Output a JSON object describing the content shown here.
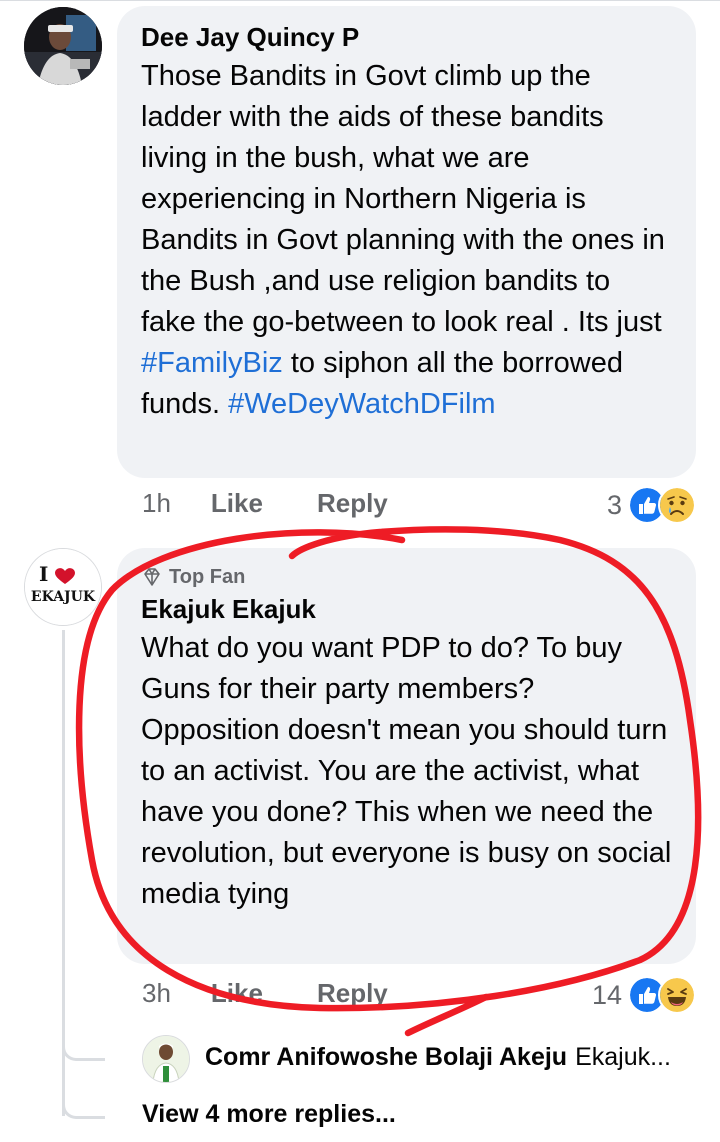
{
  "comments": [
    {
      "author": "Dee Jay Quincy P",
      "text_before": "Those Bandits in Govt climb up the ladder with the aids of these bandits living in the bush, what we are experiencing in Northern Nigeria is Bandits in Govt planning with the ones in the Bush ,and use religion bandits to fake the go-between to look real . Its just ",
      "hashtag1": "#FamilyBiz",
      "text_middle": " to siphon all the borrowed funds. ",
      "hashtag2": "#WeDeyWatchDFilm",
      "time": "1h",
      "like_label": "Like",
      "reply_label": "Reply",
      "reaction_count": "3",
      "reactions": [
        "like-reaction-icon",
        "sad-reaction-icon"
      ]
    },
    {
      "badge": "Top Fan",
      "author": "Ekajuk Ekajuk",
      "avatar_text_top": "I",
      "avatar_text_bottom": "EKAJUK",
      "text": "What do you want PDP to do? To buy Guns for their party members? Opposition doesn't mean you should turn to an activist. You are the activist, what have you done? This when we need the revolution, but everyone is busy on social media tying",
      "time": "3h",
      "like_label": "Like",
      "reply_label": "Reply",
      "reaction_count": "14",
      "reactions": [
        "like-reaction-icon",
        "haha-reaction-icon"
      ]
    }
  ],
  "reply_preview": {
    "author": "Comr Anifowoshe Bolaji Akeju",
    "snippet": "Ekajuk..."
  },
  "view_more": "View 4 more replies...",
  "colors": {
    "bubble": "#f0f2f5",
    "hashtag": "#1f6fd6",
    "annotation": "#ee1c25",
    "like_blue": "#1877f2",
    "meta_gray": "#65676b"
  }
}
